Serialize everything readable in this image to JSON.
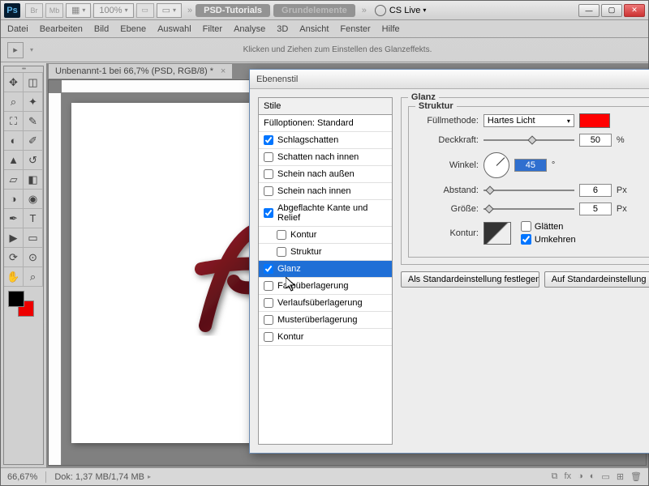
{
  "app": {
    "ps_badge": "Ps",
    "br_badge": "Br",
    "mb_badge": "Mb",
    "zoom": "100%",
    "cs_live": "CS Live"
  },
  "pills": {
    "active": "PSD-Tutorials",
    "inactive": "Grundelemente"
  },
  "menu": [
    "Datei",
    "Bearbeiten",
    "Bild",
    "Ebene",
    "Auswahl",
    "Filter",
    "Analyse",
    "3D",
    "Ansicht",
    "Fenster",
    "Hilfe"
  ],
  "optbar_hint": "Klicken und Ziehen zum Einstellen des Glanzeffekts.",
  "doc_tab": "Unbenannt-1 bei 66,7% (PSD, RGB/8) *",
  "status": {
    "zoom": "66,67%",
    "doc": "Dok: 1,37 MB/1,74 MB"
  },
  "dialog": {
    "title": "Ebenenstil",
    "list_header": "Stile",
    "fill_opts": "Fülloptionen: Standard",
    "items": [
      {
        "label": "Schlagschatten",
        "checked": true
      },
      {
        "label": "Schatten nach innen",
        "checked": false
      },
      {
        "label": "Schein nach außen",
        "checked": false
      },
      {
        "label": "Schein nach innen",
        "checked": false
      },
      {
        "label": "Abgeflachte Kante und Relief",
        "checked": true
      },
      {
        "label": "Kontur",
        "checked": false,
        "sub": true
      },
      {
        "label": "Struktur",
        "checked": false,
        "sub": true
      },
      {
        "label": "Glanz",
        "checked": true,
        "selected": true
      },
      {
        "label": "Farbüberlagerung",
        "checked": false
      },
      {
        "label": "Verlaufsüberlagerung",
        "checked": false
      },
      {
        "label": "Musterüberlagerung",
        "checked": false
      },
      {
        "label": "Kontur",
        "checked": false
      }
    ],
    "group": "Glanz",
    "subgroup": "Struktur",
    "labels": {
      "blend": "Füllmethode:",
      "opacity": "Deckkraft:",
      "angle": "Winkel:",
      "distance": "Abstand:",
      "size": "Größe:",
      "contour": "Kontur:",
      "anti": "Glätten",
      "invert": "Umkehren"
    },
    "values": {
      "blend_mode": "Hartes Licht",
      "opacity": "50",
      "opacity_unit": "%",
      "angle": "45",
      "angle_unit": "°",
      "distance": "6",
      "distance_unit": "Px",
      "size": "5",
      "size_unit": "Px",
      "color": "#ff0000",
      "invert_checked": true,
      "anti_checked": false
    },
    "buttons": {
      "default": "Als Standardeinstellung festlegen",
      "reset": "Auf Standardeinstellung"
    }
  }
}
